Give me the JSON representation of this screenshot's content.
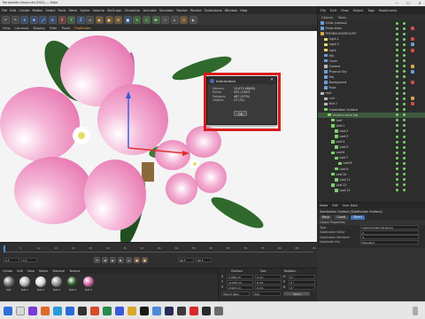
{
  "window": {
    "title": "Periwinkle-Vinca.c4d (R23) — Main",
    "minimize": "—",
    "maximize": "☐",
    "close": "✕"
  },
  "menu": [
    {
      "label": "File",
      "highlight": false
    },
    {
      "label": "Edit",
      "highlight": false
    },
    {
      "label": "Create",
      "highlight": false
    },
    {
      "label": "Modes",
      "highlight": false
    },
    {
      "label": "Select",
      "highlight": false
    },
    {
      "label": "Tools",
      "highlight": false
    },
    {
      "label": "Mesh",
      "highlight": false
    },
    {
      "label": "Spline",
      "highlight": false
    },
    {
      "label": "Volume",
      "highlight": false
    },
    {
      "label": "MoGraph",
      "highlight": false
    },
    {
      "label": "Character",
      "highlight": false
    },
    {
      "label": "Animate",
      "highlight": false
    },
    {
      "label": "Simulate",
      "highlight": false
    },
    {
      "label": "Tracker",
      "highlight": false
    },
    {
      "label": "Render",
      "highlight": false
    },
    {
      "label": "Extensions",
      "highlight": false
    },
    {
      "label": "Window",
      "highlight": false
    },
    {
      "label": "Help",
      "highlight": false
    }
  ],
  "toolbar_icons": [
    {
      "glyph": "↶",
      "name": "undo-icon",
      "tone": ""
    },
    {
      "glyph": "↷",
      "name": "redo-icon",
      "tone": ""
    },
    {
      "glyph": "⌖",
      "name": "live-select-icon",
      "tone": "b"
    },
    {
      "glyph": "✥",
      "name": "move-icon",
      "tone": "b"
    },
    {
      "glyph": "⤢",
      "name": "scale-icon",
      "tone": "b"
    },
    {
      "glyph": "⟳",
      "name": "rotate-icon",
      "tone": "b"
    },
    {
      "glyph": "X",
      "name": "x-axis-icon",
      "tone": "r"
    },
    {
      "glyph": "Y",
      "name": "y-axis-icon",
      "tone": "g"
    },
    {
      "glyph": "Z",
      "name": "z-axis-icon",
      "tone": "b"
    },
    {
      "glyph": "◎",
      "name": "coordinate-system-icon",
      "tone": ""
    },
    {
      "glyph": "▶",
      "name": "render-view-icon",
      "tone": "o"
    },
    {
      "glyph": "▣",
      "name": "render-picture-viewer-icon",
      "tone": "o"
    },
    {
      "glyph": "⚙",
      "name": "render-settings-icon",
      "tone": "o"
    },
    {
      "glyph": "■",
      "name": "cube-icon",
      "tone": "b"
    },
    {
      "glyph": "✎",
      "name": "pen-icon",
      "tone": "g"
    },
    {
      "glyph": "◇",
      "name": "subdivision-icon",
      "tone": "g"
    },
    {
      "glyph": "✚",
      "name": "array-icon",
      "tone": "g"
    },
    {
      "glyph": "⬡",
      "name": "bend-icon",
      "tone": ""
    },
    {
      "glyph": "⌂",
      "name": "floor-icon",
      "tone": ""
    },
    {
      "glyph": "☼",
      "name": "light-icon",
      "tone": "o"
    },
    {
      "glyph": "◐",
      "name": "camera-icon",
      "tone": ""
    }
  ],
  "viewport_menu": [
    {
      "label": "View",
      "active": false
    },
    {
      "label": "Cameras",
      "active": false
    },
    {
      "label": "Display",
      "active": false
    },
    {
      "label": "Filter",
      "active": false
    },
    {
      "label": "Panel",
      "active": false
    },
    {
      "label": "ProRender",
      "active": true
    }
  ],
  "dialog": {
    "title": "Information",
    "rows": [
      {
        "k": "Memory",
        "v": "13,472 KB(KB)"
      },
      {
        "k": "Points",
        "v": "522 (1007)"
      },
      {
        "k": "Polygons",
        "v": "487 (9731)"
      },
      {
        "k": "Objects",
        "v": "17 (31)"
      }
    ],
    "ok": "OK",
    "close": "✕"
  },
  "object_panel": {
    "tabs": [
      "File",
      "Edit",
      "View",
      "Object",
      "Tags",
      "Bookmarks"
    ],
    "subtabs": [
      "Objects",
      "Takes"
    ],
    "items": [
      {
        "label": "Vinka (various)",
        "indent": 0,
        "icon": "#6aa0d8",
        "sel": false,
        "tag": ""
      },
      {
        "label": "Vinka stem",
        "indent": 0,
        "icon": "#6aa0d8",
        "sel": false,
        "tag": "#d84a4a"
      },
      {
        "label": "FRESNELENVIROLEFT",
        "indent": 0,
        "icon": "#d8a84a",
        "sel": false,
        "tag": ""
      },
      {
        "label": "Light.1",
        "indent": 1,
        "icon": "#e8d86a",
        "sel": false,
        "tag": "#d84a4a"
      },
      {
        "label": "Light.2",
        "indent": 1,
        "icon": "#e8d86a",
        "sel": false,
        "tag": "#6aa0d8"
      },
      {
        "label": "Light",
        "indent": 1,
        "icon": "#e8d86a",
        "sel": false,
        "tag": "#d84a4a"
      },
      {
        "label": "Sky",
        "indent": 1,
        "icon": "#6aa0d8",
        "sel": false,
        "tag": ""
      },
      {
        "label": "Cover",
        "indent": 1,
        "icon": "#6aa0d8",
        "sel": false,
        "tag": ""
      },
      {
        "label": "Camera",
        "indent": 1,
        "icon": "#bbbbbb",
        "sel": false,
        "tag": "#d8a84a"
      },
      {
        "label": "Physical Sky",
        "indent": 1,
        "icon": "#6aa0d8",
        "sel": false,
        "tag": "#6aa0d8"
      },
      {
        "label": "Sky",
        "indent": 1,
        "icon": "#6aa0d8",
        "sel": false,
        "tag": ""
      },
      {
        "label": "Background",
        "indent": 1,
        "icon": "#6aa0d8",
        "sel": false,
        "tag": "#d84a4a"
      },
      {
        "label": "Floor",
        "indent": 1,
        "icon": "#6aa0d8",
        "sel": false,
        "tag": ""
      },
      {
        "label": "root",
        "indent": 0,
        "icon": "#bbbbbb",
        "sel": false,
        "tag": ""
      },
      {
        "label": "null",
        "indent": 1,
        "icon": "#bbbbbb",
        "sel": false,
        "tag": "#d8a84a"
      },
      {
        "label": "Null.1",
        "indent": 1,
        "icon": "#bbbbbb",
        "sel": false,
        "tag": "#d84a4a"
      },
      {
        "label": "Subdivision Surface",
        "indent": 1,
        "icon": "#7bd36a",
        "sel": false,
        "tag": ""
      },
      {
        "label": "Vincent vinca leg",
        "indent": 2,
        "icon": "#7bd36a",
        "sel": true,
        "tag": ""
      },
      {
        "label": "Leaf",
        "indent": 3,
        "icon": "#7bd36a",
        "sel": false,
        "tag": ""
      },
      {
        "label": "Leaf.1",
        "indent": 3,
        "icon": "#7bd36a",
        "sel": false,
        "tag": ""
      },
      {
        "label": "Leaf.2",
        "indent": 4,
        "icon": "#7bd36a",
        "sel": false,
        "tag": ""
      },
      {
        "label": "Leaf.3",
        "indent": 4,
        "icon": "#7bd36a",
        "sel": false,
        "tag": ""
      },
      {
        "label": "Leaf.4",
        "indent": 3,
        "icon": "#7bd36a",
        "sel": false,
        "tag": ""
      },
      {
        "label": "Leaf.5",
        "indent": 4,
        "icon": "#7bd36a",
        "sel": false,
        "tag": ""
      },
      {
        "label": "Leaf.6",
        "indent": 3,
        "icon": "#7bd36a",
        "sel": false,
        "tag": ""
      },
      {
        "label": "Leaf.7",
        "indent": 4,
        "icon": "#7bd36a",
        "sel": false,
        "tag": ""
      },
      {
        "label": "Leaf.8",
        "indent": 5,
        "icon": "#7bd36a",
        "sel": false,
        "tag": ""
      },
      {
        "label": "Leaf.9",
        "indent": 4,
        "icon": "#7bd36a",
        "sel": false,
        "tag": ""
      },
      {
        "label": "Leaf.10",
        "indent": 3,
        "icon": "#7bd36a",
        "sel": false,
        "tag": ""
      },
      {
        "label": "Leaf.11",
        "indent": 4,
        "icon": "#7bd36a",
        "sel": false,
        "tag": ""
      },
      {
        "label": "Leaf.12",
        "indent": 3,
        "icon": "#7bd36a",
        "sel": false,
        "tag": ""
      },
      {
        "label": "Leaf.13",
        "indent": 4,
        "icon": "#7bd36a",
        "sel": false,
        "tag": ""
      }
    ]
  },
  "attributes": {
    "tabs": [
      "Mode",
      "Edit",
      "User Data"
    ],
    "object_title": "Subdivision Surface [Subdivision Surface]",
    "subtabs": [
      "Basic",
      "Coord.",
      "Object"
    ],
    "section": "Object Properties",
    "fields": [
      {
        "k": "Type",
        "v": "Catmull-Clark (N-Gons)"
      },
      {
        "k": "Subdivision Editor",
        "v": "2"
      },
      {
        "k": "Subdivision Renderer",
        "v": "3"
      },
      {
        "k": "Subdivide UVs",
        "v": "Standard"
      }
    ]
  },
  "timeline": {
    "ticks": [
      "0",
      "5",
      "10",
      "15",
      "20",
      "25",
      "30",
      "35",
      "40",
      "45",
      "50",
      "55",
      "60",
      "65",
      "70",
      "75",
      "80",
      "85",
      "90"
    ],
    "frame_start": "0 F",
    "frame_current": "0 F",
    "frame_end": "90 F",
    "frame_end2": "90 F",
    "frame_display": "0 F"
  },
  "materials": {
    "menu": [
      "Create",
      "Edit",
      "View",
      "Select",
      "Material",
      "Texture"
    ],
    "swatches": [
      {
        "label": "Mat",
        "color": "#7a7a7a"
      },
      {
        "label": "Mat.1",
        "color": "#bcbcbc"
      },
      {
        "label": "Mat.2",
        "color": "#e0e0e0"
      },
      {
        "label": "Mat.3",
        "color": "#9a9a9a"
      },
      {
        "label": "Mat.4",
        "color": "#2d5a2a"
      },
      {
        "label": "Mat.5",
        "color": "#d86aa8"
      }
    ]
  },
  "coordinates": {
    "headers": [
      "Position",
      "Size",
      "Rotation"
    ],
    "rows": [
      {
        "axis": "X",
        "pos": "4.306 cm",
        "size": "0 cm",
        "rot_axis": "H",
        "rot": "0 °"
      },
      {
        "axis": "Y",
        "pos": "-0.216 cm",
        "size": "0 cm",
        "rot_axis": "P",
        "rot": "0 °"
      },
      {
        "axis": "Z",
        "pos": "4.323 cm",
        "size": "0 cm",
        "rot_axis": "B",
        "rot": "0 °"
      }
    ],
    "mode1": "Object (Rel)",
    "mode2": "Size",
    "apply": "Apply"
  },
  "colors": {
    "accent": "#e8a33a",
    "highlight_box": "#d61d1d",
    "petal": "#e778b4"
  }
}
